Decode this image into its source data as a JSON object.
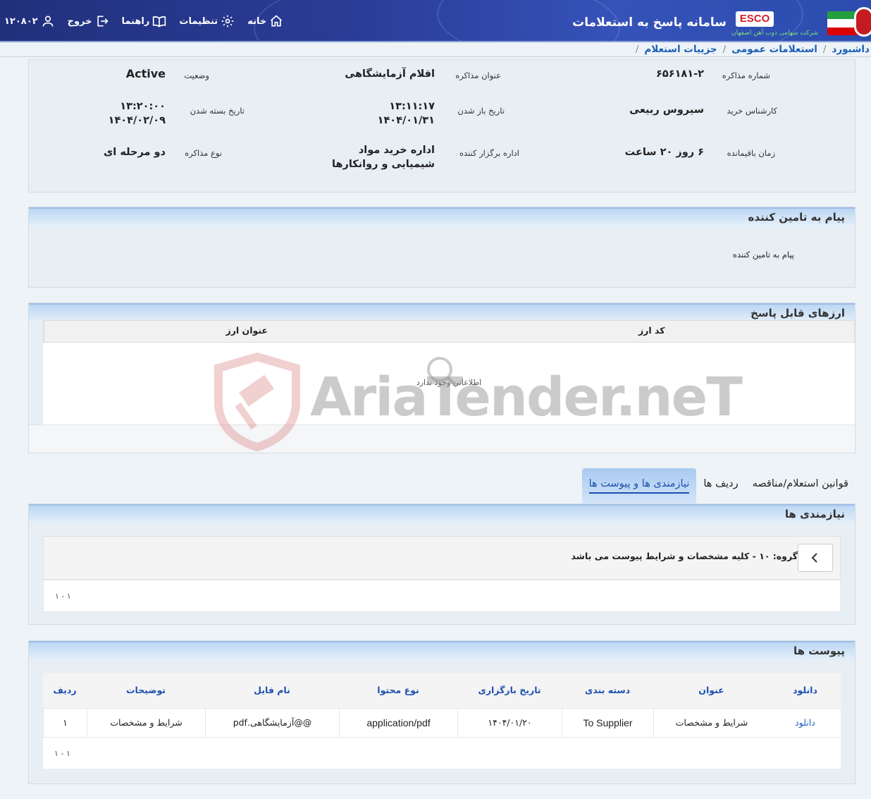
{
  "header": {
    "app_title": "سامانه پاسخ به استعلامات",
    "logo_text": "ESCO",
    "logo_sub": "شرکت سهامی ذوب آهن اصفهان",
    "nav": {
      "home": "خانه",
      "settings": "تنظیمات",
      "guide": "راهنما",
      "logout": "خروج",
      "user_id": "۱۲۰۸۰۲"
    }
  },
  "breadcrumb": [
    "داشبورد",
    "استعلامات عمومی",
    "جزییات استعلام"
  ],
  "summary": {
    "number_label": "شماره مذاکره",
    "number": "۶۵۶۱۸۱-۲",
    "title_label": "عنوان مذاکره",
    "title": "اقلام آزمایشگاهی",
    "status_label": "وضعیت",
    "status": "Active",
    "expert_label": "کارشناس خرید",
    "expert": "سیروس ربیعی",
    "open_label": "تاریخ باز شدن",
    "open_time": "۱۳:۱۱:۱۷",
    "open_date": "۱۴۰۴/۰۱/۳۱",
    "close_label": "تاریخ بسته شدن",
    "close_time": "۱۳:۲۰:۰۰",
    "close_date": "۱۴۰۴/۰۲/۰۹",
    "remaining_label": "زمان باقیمانده",
    "remaining": "۶ روز ۲۰ ساعت",
    "org_label": "اداره برگزار کننده",
    "org": "اداره خرید مواد شیمیایی و روانکارها",
    "type_label": "نوع مذاکره",
    "type": "دو مرحله ای"
  },
  "message": {
    "title": "پیام به تامین کننده",
    "body": "پیام به تامین کننده"
  },
  "currencies": {
    "title": "ارزهای قابل پاسخ",
    "columns": [
      "کد ارز",
      "عنوان ارز"
    ],
    "empty": "اطلاعاتی وجود ندارد"
  },
  "tabs": [
    "نیازمندی ها و پیوست ها",
    "ردیف ها",
    "قوانین استعلام/مناقصه"
  ],
  "needs": {
    "title": "نیازمندی ها",
    "group": "گروه: ۱۰ - کلیه مشخصات و شرایط پیوست می باشد",
    "pager": "۱ - ۱"
  },
  "attachments": {
    "title": "پیوست ها",
    "columns": [
      "ردیف",
      "توضیحات",
      "نام فایل",
      "نوع محتوا",
      "تاریخ بارگزاری",
      "دسته بندی",
      "عنوان",
      "دانلود"
    ],
    "rows": [
      {
        "index": "۱",
        "description": "شرایط و مشخصات",
        "file_name": "@@آزمایشگاهی.pdf",
        "content_type": "application/pdf",
        "upload_date": "۱۴۰۴/۰۱/۲۰",
        "category": "To Supplier",
        "title": "شرایط و مشخصات",
        "download": "دانلود"
      }
    ],
    "pager": "۱ - ۱"
  },
  "watermark": "AriaTender.neT"
}
